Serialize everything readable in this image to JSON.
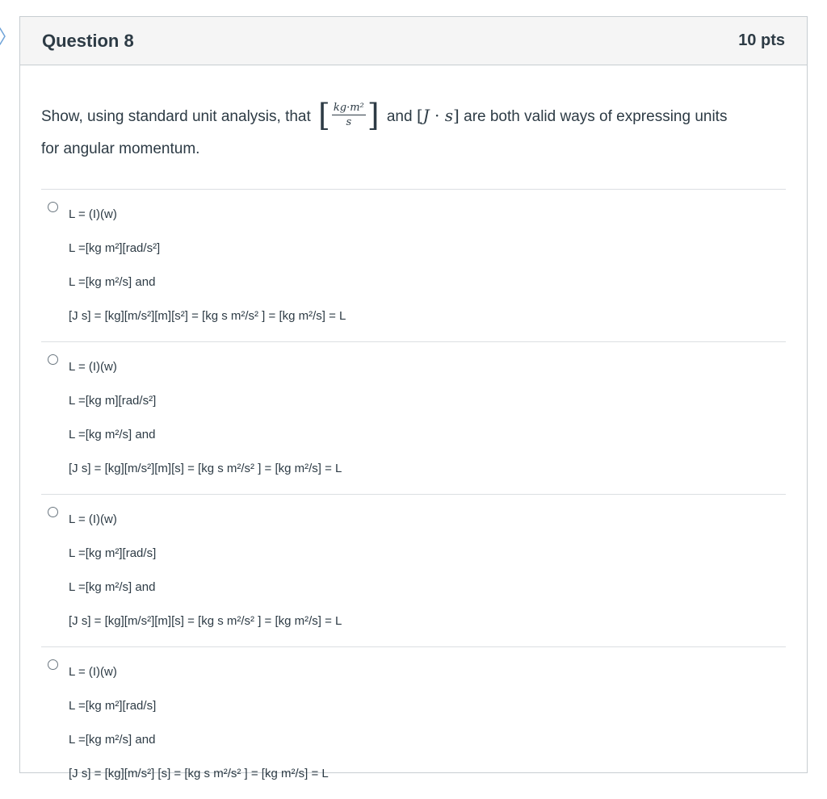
{
  "question": {
    "title": "Question 8",
    "points": "10 pts",
    "text_before": "Show, using standard unit analysis, that",
    "frac_numerator": "kg·m²",
    "frac_denominator": "s",
    "text_and": "and",
    "j_unit_J": "J",
    "j_unit_dot": " · ",
    "j_unit_s": "s",
    "text_after": "are both valid ways of expressing units",
    "text_line2": "for angular momentum."
  },
  "answers": [
    {
      "lines": [
        "L = (I)(w)",
        "L =[kg m²][rad/s²]",
        "L =[kg m²/s] and",
        "[J s] = [kg][m/s²][m][s²] = [kg s m²/s² ] = [kg m²/s] = L"
      ]
    },
    {
      "lines": [
        "L = (I)(w)",
        "L =[kg m][rad/s²]",
        "L =[kg m²/s] and",
        "[J s] = [kg][m/s²][m][s] = [kg s m²/s² ] = [kg m²/s] = L"
      ]
    },
    {
      "lines": [
        "L = (I)(w)",
        "L =[kg m²][rad/s]",
        "L =[kg m²/s] and",
        "[J s] = [kg][m/s²][m][s] = [kg s m²/s² ] = [kg m²/s] = L"
      ]
    },
    {
      "lines": [
        "L = (I)(w)",
        "L =[kg m²][rad/s]",
        "L =[kg m²/s] and",
        "[J s] = [kg][m/s²] [s] = [kg s m²/s² ] = [kg m²/s] = L"
      ]
    }
  ],
  "colors": {
    "text": "#2d3b45",
    "border": "#c7cdd1",
    "header_bg": "#f5f5f5",
    "flag": "#6fa3d8"
  },
  "icons": {
    "flag": "question-flag-icon"
  }
}
